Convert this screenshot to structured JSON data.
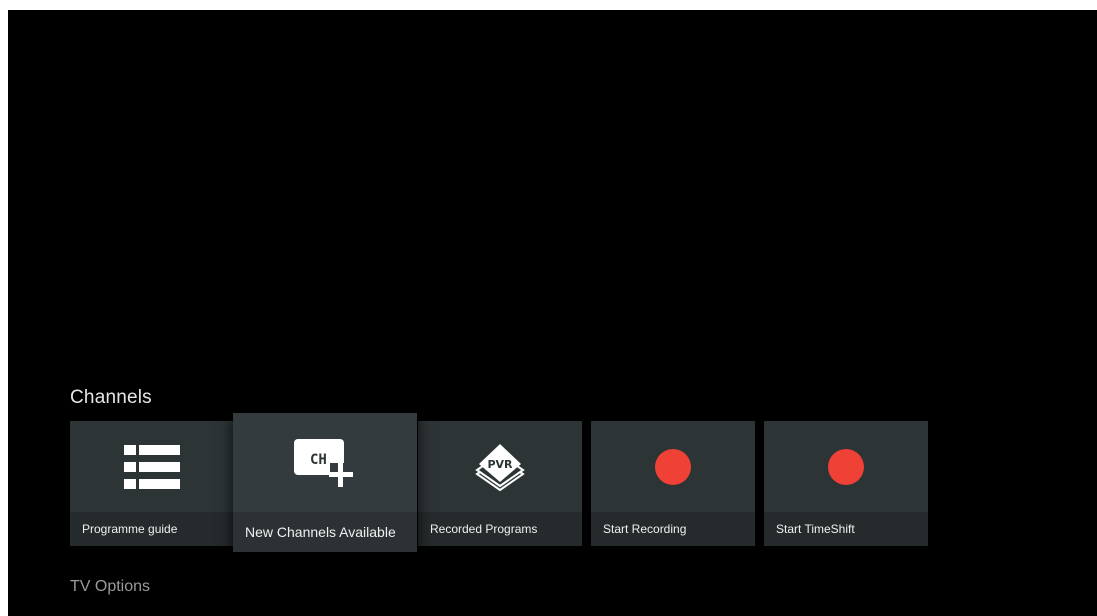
{
  "sections": {
    "channels_title": "Channels",
    "tv_options_title": "TV Options"
  },
  "tiles": [
    {
      "label": "Programme guide",
      "icon": "list-icon"
    },
    {
      "label": "New Channels Available",
      "icon": "channel-add-icon",
      "icon_text": "CH"
    },
    {
      "label": "Recorded Programs",
      "icon": "pvr-icon",
      "icon_text": "PVR"
    },
    {
      "label": "Start Recording",
      "icon": "record-dot-icon"
    },
    {
      "label": "Start TimeShift",
      "icon": "record-dot-icon"
    }
  ],
  "colors": {
    "background": "#000000",
    "tile": "#2d3436",
    "record_red": "#ef4135"
  }
}
